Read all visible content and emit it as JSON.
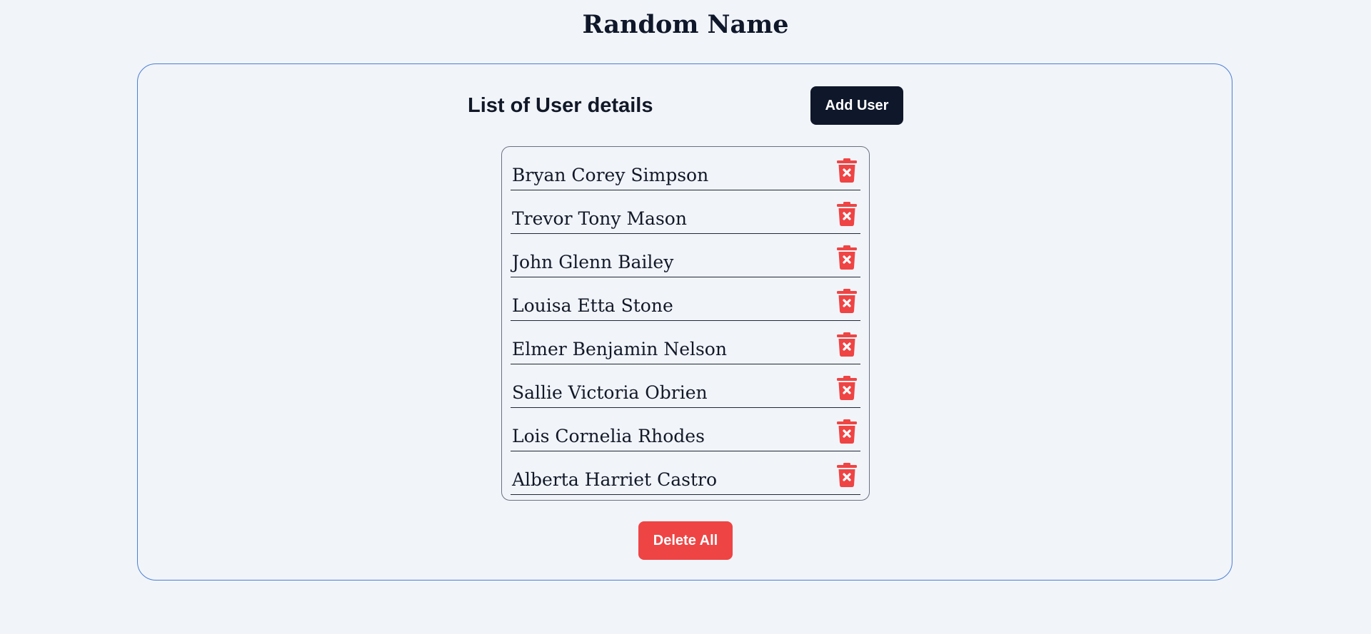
{
  "page": {
    "title": "Random Name"
  },
  "panel": {
    "heading": "List of User details",
    "add_user_label": "Add User",
    "delete_all_label": "Delete All"
  },
  "users": [
    {
      "name": "Bryan Corey Simpson",
      "icon": "trash-x-icon"
    },
    {
      "name": "Trevor Tony Mason",
      "icon": "trash-x-icon"
    },
    {
      "name": "John Glenn Bailey",
      "icon": "trash-x-icon"
    },
    {
      "name": "Louisa Etta Stone",
      "icon": "trash-x-icon"
    },
    {
      "name": "Elmer Benjamin Nelson",
      "icon": "trash-x-icon"
    },
    {
      "name": "Sallie Victoria Obrien",
      "icon": "trash-x-icon"
    },
    {
      "name": "Lois Cornelia Rhodes",
      "icon": "trash-x-icon"
    },
    {
      "name": "Alberta Harriet Castro",
      "icon": "trash-x-icon"
    }
  ],
  "colors": {
    "background": "#f1f4f9",
    "panel_border": "#4a7fd6",
    "add_button": "#0f172a",
    "delete": "#ef4444",
    "text": "#111827"
  }
}
